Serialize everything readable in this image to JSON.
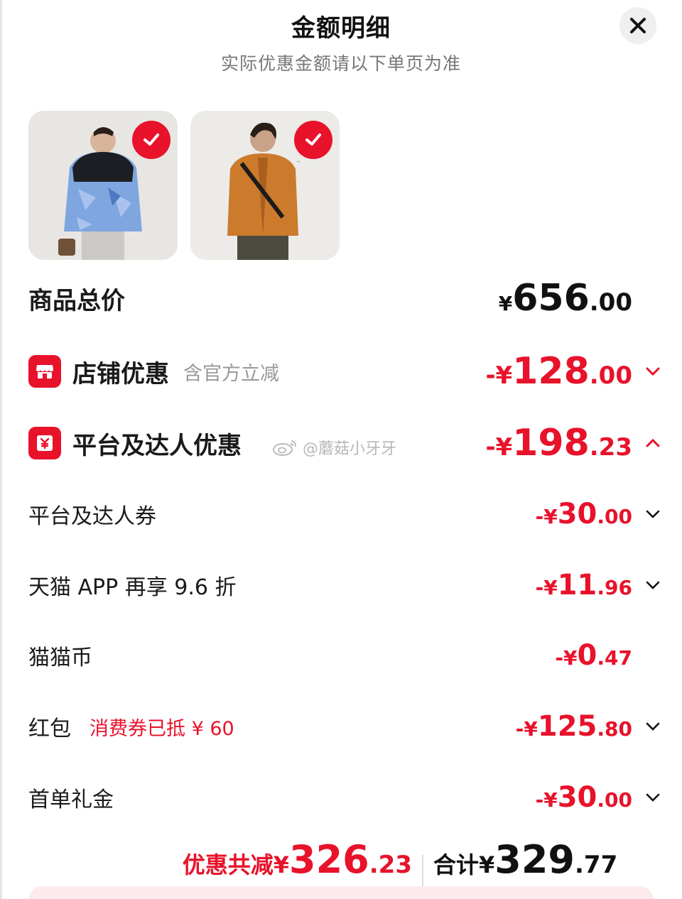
{
  "header": {
    "title": "金额明细",
    "subtitle": "实际优惠金额请以下单页为准"
  },
  "products": [
    {
      "alt": "儿童羽绒服",
      "selected": true
    },
    {
      "alt": "橙色外套",
      "selected": true
    }
  ],
  "total_row": {
    "label": "商品总价",
    "currency": "¥",
    "int": "656",
    "dec": ".00"
  },
  "store_discount": {
    "label": "店铺优惠",
    "note": "含官方立减",
    "currency": "-¥",
    "int": "128",
    "dec": ".00"
  },
  "platform_discount": {
    "label": "平台及达人优惠",
    "currency": "-¥",
    "int": "198",
    "dec": ".23"
  },
  "watermark": {
    "text": "@蘑菇小牙牙"
  },
  "items": [
    {
      "label": "平台及达人券",
      "note": "",
      "currency": "-¥",
      "int": "30",
      "dec": ".00",
      "expand": true
    },
    {
      "label": "天猫 APP 再享 9.6 折",
      "note": "",
      "currency": "-¥",
      "int": "11",
      "dec": ".96",
      "expand": true
    },
    {
      "label": "猫猫币",
      "note": "",
      "currency": "-¥",
      "int": "0",
      "dec": ".47",
      "expand": false
    },
    {
      "label": "红包",
      "note": "消费券已抵 ¥ 60",
      "currency": "-¥",
      "int": "125",
      "dec": ".80",
      "expand": true
    },
    {
      "label": "首单礼金",
      "note": "",
      "currency": "-¥",
      "int": "30",
      "dec": ".00",
      "expand": true
    }
  ],
  "footer": {
    "discount_label": "优惠共减¥",
    "discount_int": "326",
    "discount_dec": ".23",
    "total_label": "合计¥",
    "total_int": "329",
    "total_dec": ".77"
  },
  "colors": {
    "accent": "#e8122b",
    "text": "#1a1a1a",
    "muted": "#999999"
  }
}
